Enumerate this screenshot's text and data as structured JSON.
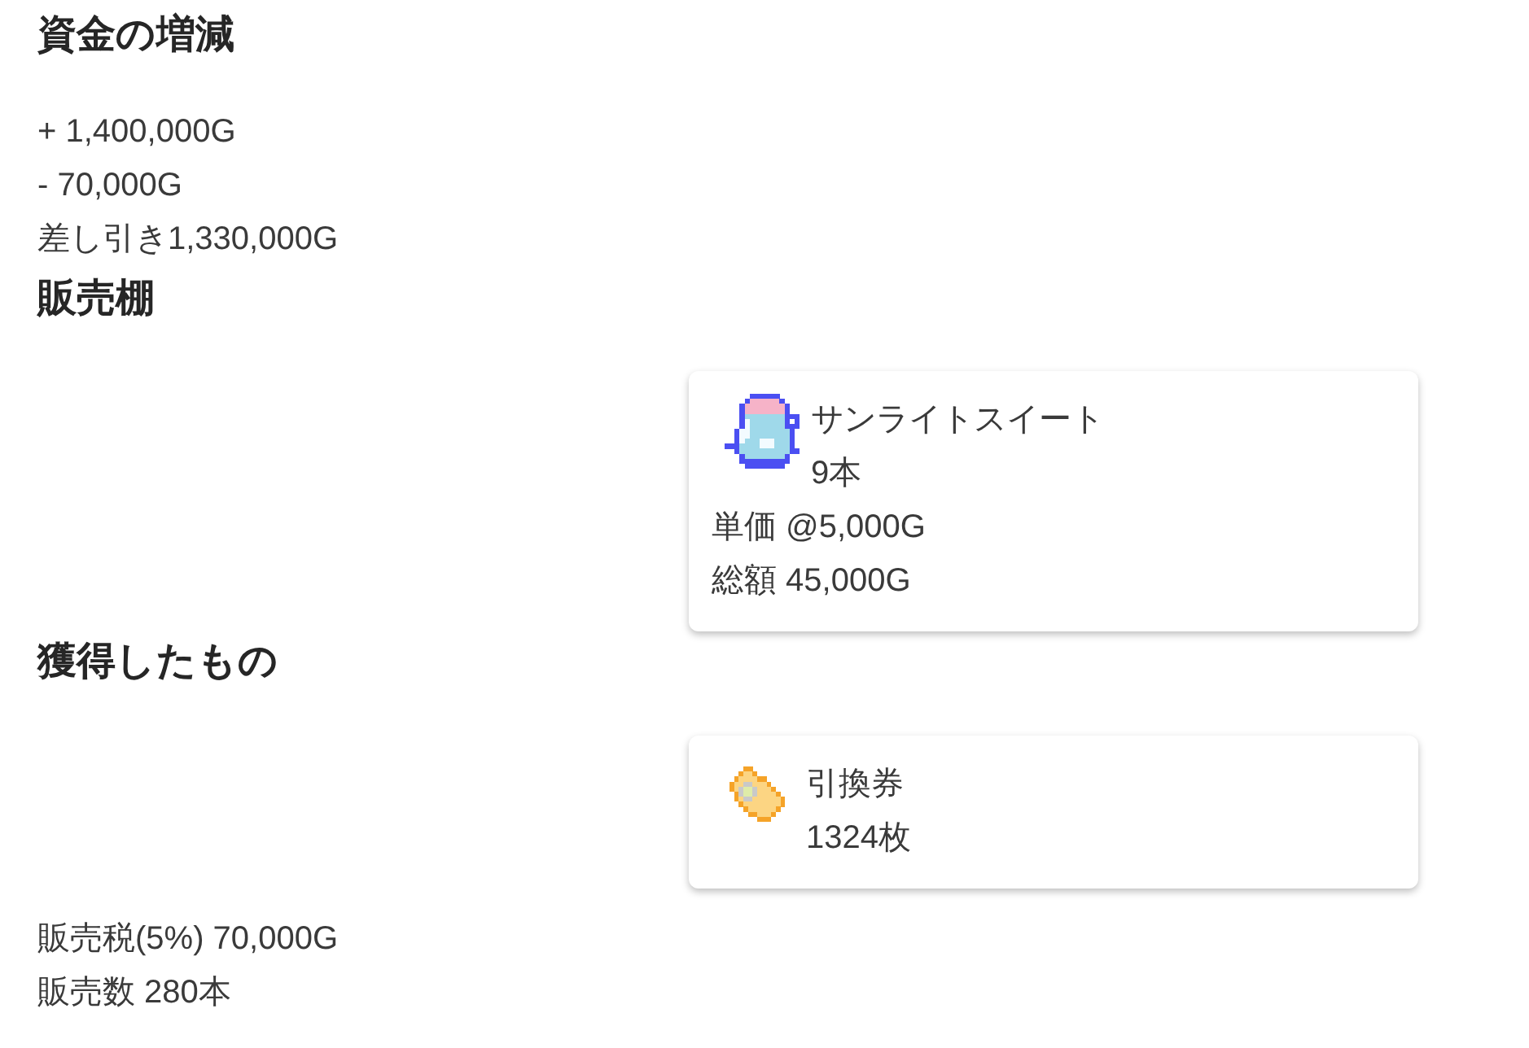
{
  "funds": {
    "heading": "資金の増減",
    "lines": [
      "+ 1,400,000G",
      "- 70,000G",
      "差し引き1,330,000G"
    ]
  },
  "shelf": {
    "heading": "販売棚",
    "items": [
      {
        "name": "サンライトスイート",
        "quantity": "9本",
        "unit_price": "単価 @5,000G",
        "total": "総額 45,000G"
      }
    ]
  },
  "obtained": {
    "heading": "獲得したもの",
    "items": [
      {
        "name": "引換券",
        "quantity": "1324枚"
      }
    ]
  },
  "summary": [
    "販売税(5%) 70,000G",
    "販売数 280本"
  ]
}
